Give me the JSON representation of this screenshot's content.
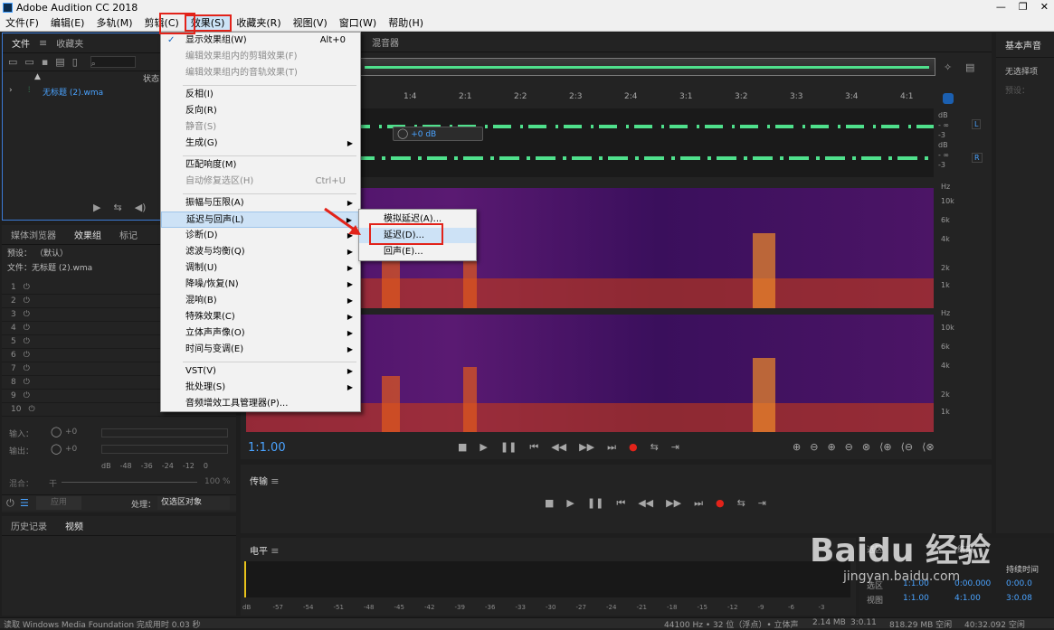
{
  "title": "Adobe Audition CC 2018",
  "window_buttons": [
    "—",
    "❐",
    "✕"
  ],
  "menu": [
    "文件(F)",
    "编辑(E)",
    "多轨(M)",
    "剪辑(C)",
    "效果(S)",
    "收藏夹(R)",
    "视图(V)",
    "窗口(W)",
    "帮助(H)"
  ],
  "files_panel": {
    "tab1": "文件",
    "tab2": "收藏夹",
    "col_status": "状态",
    "file": "无标题 (2).wma"
  },
  "effects_panel": {
    "tab1": "媒体浏览器",
    "tab2": "效果组",
    "tab3": "标记",
    "preset_label": "预设：",
    "preset_value": "（默认）",
    "file_label": "文件：无标题 (2).wma",
    "rows": [
      "1",
      "2",
      "3",
      "4",
      "5",
      "6",
      "7",
      "8",
      "9",
      "10"
    ],
    "input": "输入：",
    "output": "输出：",
    "in_db": "+0",
    "out_db": "+0",
    "meter_labels": [
      "dB",
      "-48",
      "-36",
      "-24",
      "-12",
      "0"
    ],
    "mix_label": "混合：",
    "mix_dry": "干",
    "mix_pct": "100 %",
    "apply": "应用",
    "process_label": "处理：",
    "process_value": "仅选区对象"
  },
  "history": {
    "tab1": "历史记录",
    "tab2": "视频"
  },
  "editor": {
    "tab": "混音器",
    "gain": "+0 dB",
    "time": "1:1.00"
  },
  "ruler": [
    "1:4",
    "2:1",
    "2:2",
    "2:3",
    "2:4",
    "3:1",
    "3:2",
    "3:3",
    "3:4",
    "4:1"
  ],
  "amp_labels": {
    "db": "dB",
    "inf": "- ∞",
    "m3": "-3",
    "L": "L",
    "R": "R"
  },
  "hz_labels": [
    "Hz",
    "10k",
    "6k",
    "4k",
    "2k",
    "1k"
  ],
  "transport": {
    "panel": "传输"
  },
  "level": {
    "panel": "电平",
    "scale": [
      "dB",
      "-57",
      "-54",
      "-51",
      "-48",
      "-45",
      "-42",
      "-39",
      "-36",
      "-33",
      "-30",
      "-27",
      "-24",
      "-21",
      "-18",
      "-15",
      "-12",
      "-9",
      "-6",
      "-3"
    ]
  },
  "right_panel": {
    "title": "基本声音",
    "no_selection": "无选择项",
    "preset": "预设："
  },
  "selection": {
    "header1": "选区",
    "header2": "结束",
    "header3": "持续时间",
    "row1": "选区",
    "row2": "视图",
    "v1": "1:1.00",
    "v2": "0:00.000",
    "v3": "1:1.00",
    "v4": "4:1.00",
    "d1": "0:00.0",
    "d2": "3:0.08"
  },
  "dropdown": {
    "show": "显示效果组(W)",
    "show_sc": "Alt+0",
    "edit_clip": "编辑效果组内的剪辑效果(F)",
    "edit_track": "编辑效果组内的音轨效果(T)",
    "invert": "反相(I)",
    "reverse": "反向(R)",
    "silence": "静音(S)",
    "generate": "生成(G)",
    "match": "匹配响度(M)",
    "auto_heal": "自动修复选区(H)",
    "auto_heal_sc": "Ctrl+U",
    "amp": "振幅与压限(A)",
    "delay": "延迟与回声(L)",
    "diag": "诊断(D)",
    "filter": "滤波与均衡(Q)",
    "mod": "调制(U)",
    "noise": "降噪/恢复(N)",
    "reverb": "混响(B)",
    "special": "特殊效果(C)",
    "stereo": "立体声声像(O)",
    "time": "时间与变调(E)",
    "vst": "VST(V)",
    "batch": "批处理(S)",
    "plugin": "音频增效工具管理器(P)..."
  },
  "submenu": {
    "analog": "模拟延迟(A)...",
    "delay": "延迟(D)...",
    "echo": "回声(E)..."
  },
  "status": {
    "left": "读取 Windows Media Foundation 完成用时 0.03 秒",
    "rate": "44100 Hz • 32 位（浮点）• 立体声",
    "size": "2.14 MB",
    "dur": "3:0.11",
    "free": "818.29 MB 空闲",
    "time": "40:32.092 空闲"
  },
  "watermark": {
    "brand": "Baidu 经验",
    "url": "jingyan.baidu.com"
  },
  "colors": {
    "accent_red": "#e2231a",
    "wave_green": "#4fe08c",
    "blue": "#4aa3ff"
  }
}
